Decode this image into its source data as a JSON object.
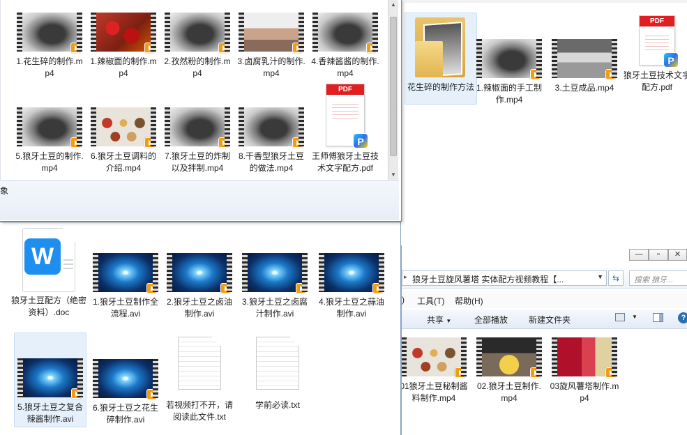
{
  "topleft": {
    "row1": [
      {
        "label": "1.花生碎的制作.mp4",
        "style": "wok"
      },
      {
        "label": "1.辣椒面的制作.mp4",
        "style": "chili"
      },
      {
        "label": "2.孜然粉的制作.mp4",
        "style": "wok"
      },
      {
        "label": "3.卤腐乳汁的制作.mp4",
        "style": "meat"
      },
      {
        "label": "4.香辣酱酱的制作.mp4",
        "style": "wok"
      }
    ],
    "row2": [
      {
        "label": "5.狼牙土豆的制作.mp4",
        "style": "wok"
      },
      {
        "label": "6.狼牙土豆调料的介绍.mp4",
        "style": "bowls"
      },
      {
        "label": "7.狼牙土豆的炸制以及拌制.mp4",
        "style": "wok"
      },
      {
        "label": "8.干香型狼牙土豆的做法.mp4",
        "style": "wok"
      }
    ],
    "pdf_label": "王师傅狼牙土豆技术文字配方.pdf",
    "status_fragment": "象"
  },
  "topright": {
    "folder_label": "花生碎的制作方法",
    "videos": [
      {
        "label": "1.辣椒面的手工制作.mp4",
        "style": "wok"
      },
      {
        "label": "3.土豆成品.mp4",
        "style": "kitchen"
      }
    ],
    "pdf_label": "狼牙土豆技术文字配方.pdf"
  },
  "bottomleft": {
    "doc_label": "狼牙土豆配方（绝密资料）.doc",
    "row1": [
      {
        "label": "1.狼牙土豆制作全流程.avi"
      },
      {
        "label": "2.狼牙土豆之卤油制作.avi"
      },
      {
        "label": "3.狼牙土豆之卤腐汁制作.avi"
      },
      {
        "label": "4.狼牙土豆之蒜油制作.avi"
      }
    ],
    "row2": [
      {
        "label": "5.狼牙土豆之复合辣酱制作.avi"
      },
      {
        "label": "6.狼牙土豆之花生碎制作.avi"
      }
    ],
    "txt_files": [
      {
        "label": "若视频打不开，请阅读此文件.txt"
      },
      {
        "label": "学前必读.txt"
      }
    ]
  },
  "bottomright": {
    "address": "狼牙土豆旋风薯塔 实体配方视频教程【...",
    "search_placeholder": "搜索 狼牙...",
    "menu": {
      "tools": "工具(T)",
      "help": "帮助(H)"
    },
    "toolbar": {
      "share": "共享",
      "play_all": "全部播放",
      "new_folder": "新建文件夹"
    },
    "videos": [
      {
        "label": "01狼牙土豆秘制酱料制作.mp4",
        "style": "bowls"
      },
      {
        "label": "02.狼牙土豆制作.mp4",
        "style": "fries"
      },
      {
        "label": "03旋风薯塔制作.mp4",
        "style": "red"
      }
    ]
  }
}
